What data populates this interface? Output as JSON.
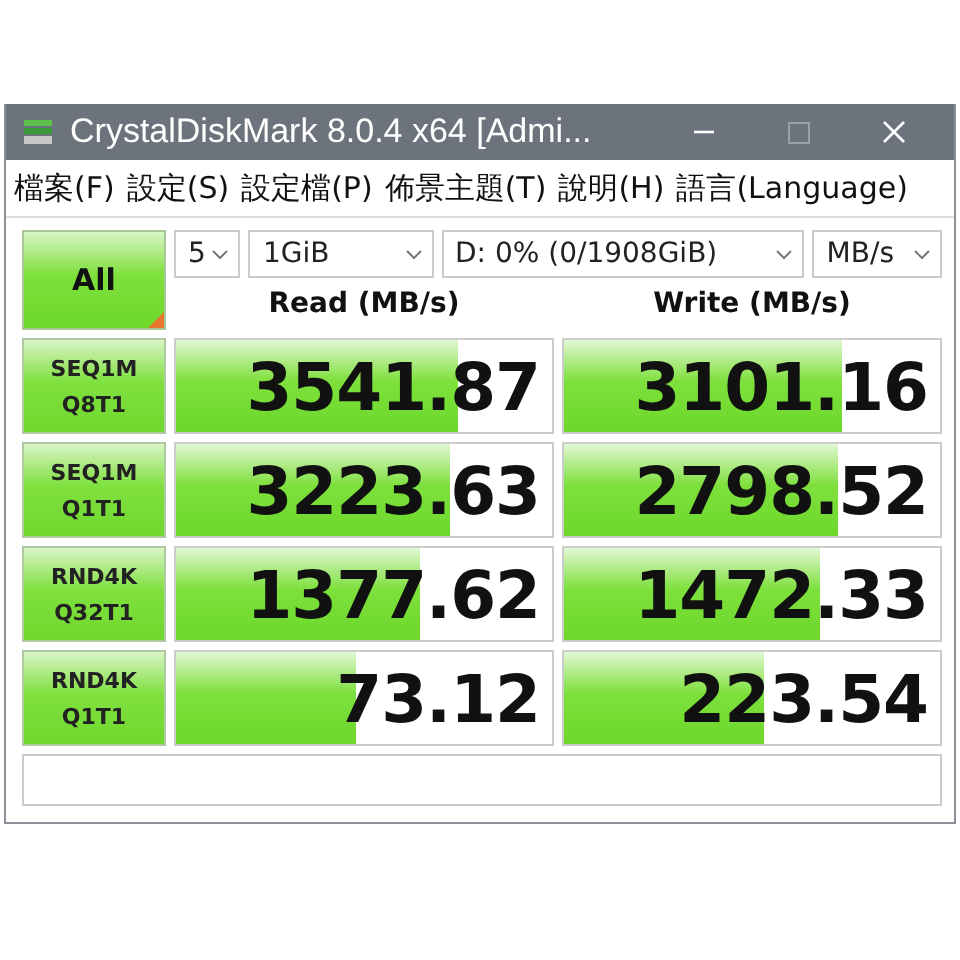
{
  "window": {
    "title": "CrystalDiskMark 8.0.4 x64 [Admi..."
  },
  "menu": [
    {
      "label": "檔案(F)"
    },
    {
      "label": "設定(S)"
    },
    {
      "label": "設定檔(P)"
    },
    {
      "label": "佈景主題(T)"
    },
    {
      "label": "說明(H)"
    },
    {
      "label": "語言(Language)"
    }
  ],
  "all_button": {
    "label": "All"
  },
  "selectors": [
    {
      "value": "5"
    },
    {
      "value": "1GiB"
    },
    {
      "value": "D: 0% (0/1908GiB)"
    },
    {
      "value": "MB/s"
    }
  ],
  "columns": [
    "Read (MB/s)",
    "Write (MB/s)"
  ],
  "tests": [
    {
      "line1": "SEQ1M",
      "line2": "Q8T1",
      "read": {
        "value": "3541.87",
        "level": 0.75
      },
      "write": {
        "value": "3101.16",
        "level": 0.74
      }
    },
    {
      "line1": "SEQ1M",
      "line2": "Q1T1",
      "read": {
        "value": "3223.63",
        "level": 0.73
      },
      "write": {
        "value": "2798.52",
        "level": 0.73
      }
    },
    {
      "line1": "RND4K",
      "line2": "Q32T1",
      "read": {
        "value": "1377.62",
        "level": 0.65
      },
      "write": {
        "value": "1472.33",
        "level": 0.68
      }
    },
    {
      "line1": "RND4K",
      "line2": "Q1T1",
      "read": {
        "value": "73.12",
        "level": 0.48
      },
      "write": {
        "value": "223.54",
        "level": 0.53
      }
    }
  ]
}
